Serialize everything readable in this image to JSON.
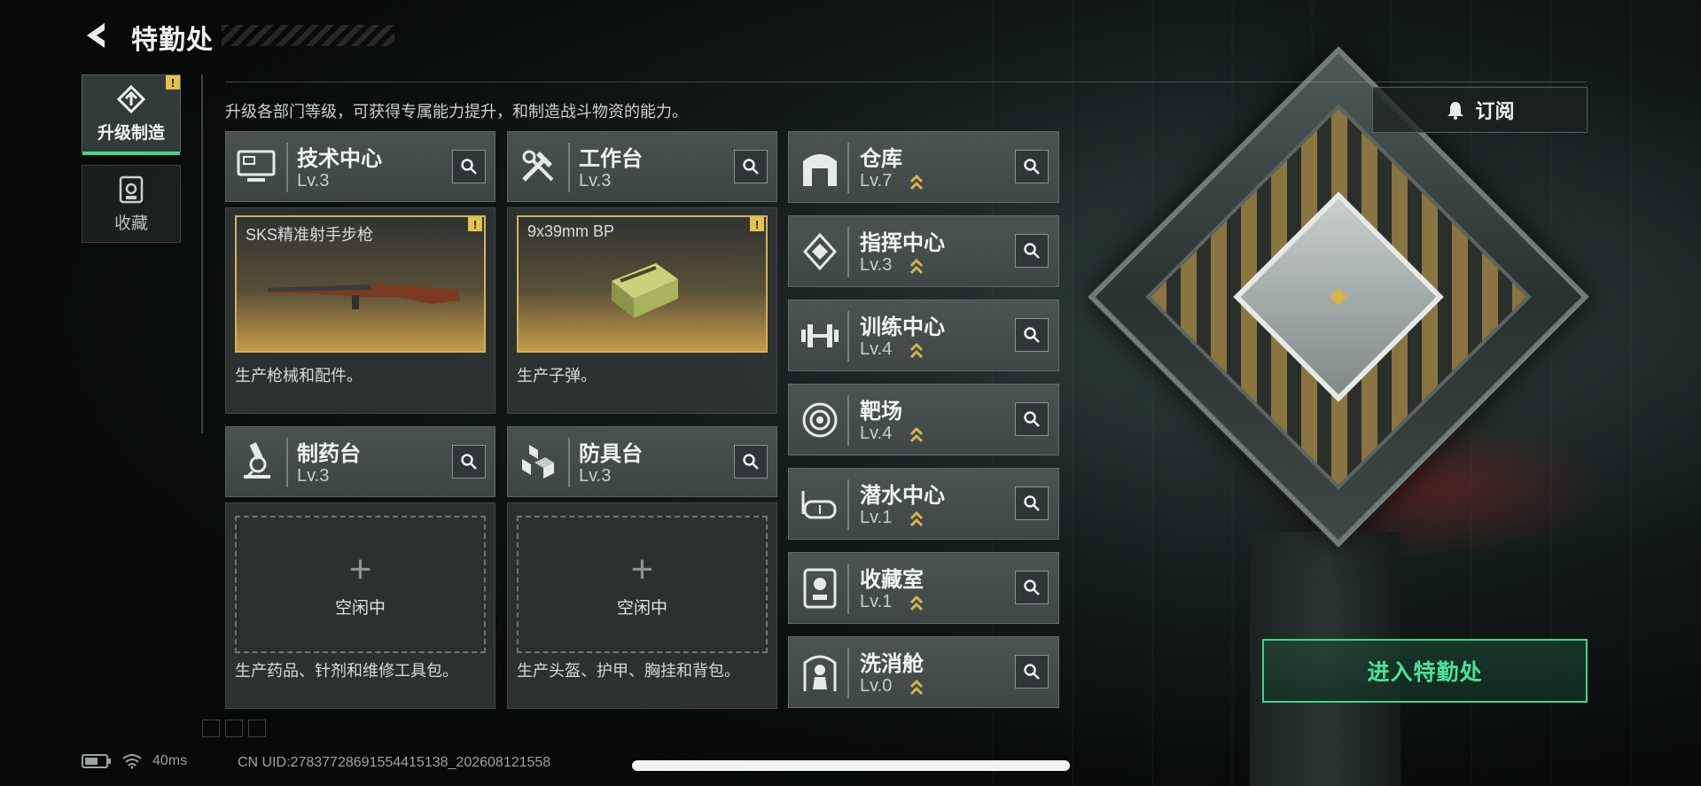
{
  "header": {
    "title": "特勤处"
  },
  "nav": [
    {
      "label": "升级制造",
      "active": true,
      "warning": "!"
    },
    {
      "label": "收藏",
      "active": false
    }
  ],
  "subtitle": "升级各部门等级，可获得专属能力提升，和制造战斗物资的能力。",
  "subscribe_label": "订阅",
  "departments": [
    {
      "name": "技术中心",
      "level": "Lv.3",
      "icon": "monitor-icon",
      "production": {
        "item": "SKS精准射手步枪",
        "warning": "!"
      },
      "desc": "生产枪械和配件。"
    },
    {
      "name": "工作台",
      "level": "Lv.3",
      "icon": "tools-icon",
      "production": {
        "item": "9x39mm BP",
        "warning": "!"
      },
      "desc": "生产子弹。"
    },
    {
      "name": "制药台",
      "level": "Lv.3",
      "icon": "microscope-icon",
      "idle_label": "空闲中",
      "desc": "生产药品、针剂和维修工具包。"
    },
    {
      "name": "防具台",
      "level": "Lv.3",
      "icon": "armor-blocks-icon",
      "idle_label": "空闲中",
      "desc": "生产头盔、护甲、胸挂和背包。"
    }
  ],
  "facilities": [
    {
      "name": "仓库",
      "level": "Lv.7",
      "icon": "warehouse-icon"
    },
    {
      "name": "指挥中心",
      "level": "Lv.3",
      "icon": "command-icon"
    },
    {
      "name": "训练中心",
      "level": "Lv.4",
      "icon": "dumbbell-icon"
    },
    {
      "name": "靶场",
      "level": "Lv.4",
      "icon": "target-icon"
    },
    {
      "name": "潜水中心",
      "level": "Lv.1",
      "icon": "diving-mask-icon"
    },
    {
      "name": "收藏室",
      "level": "Lv.1",
      "icon": "trophy-case-icon"
    },
    {
      "name": "洗消舱",
      "level": "Lv.0",
      "icon": "decon-icon"
    }
  ],
  "enter_button": "进入特勤处",
  "status": {
    "ping": "40ms",
    "uid": "CN UID:27837728691554415138_202608121558"
  },
  "colors": {
    "accent": "#3bd68b",
    "warning": "#e3c34d",
    "upgrade": "#d6b34f"
  }
}
